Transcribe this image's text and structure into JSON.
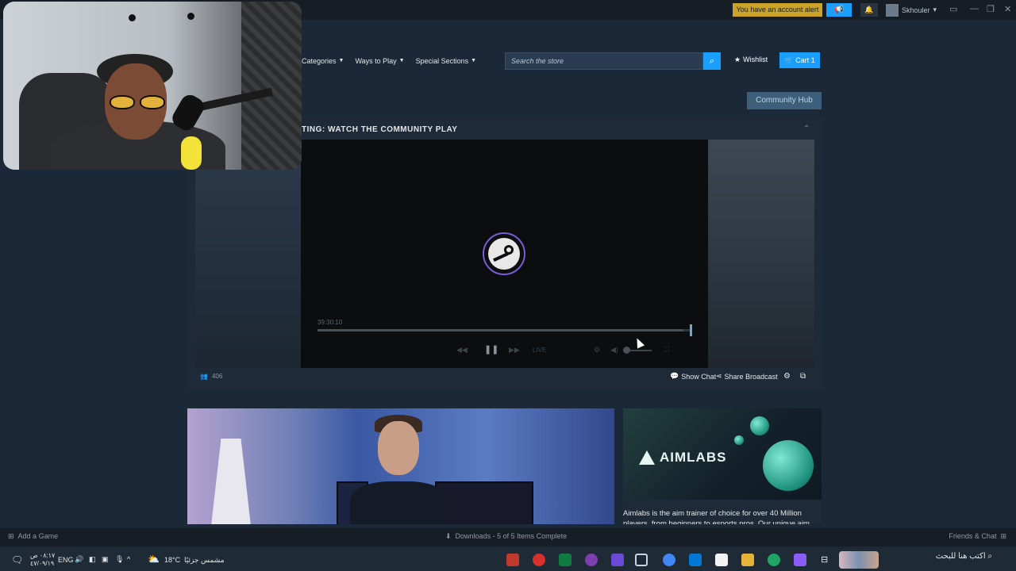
{
  "titlebar": {
    "alert": "You have an account alert",
    "username": "Skhouler"
  },
  "nav": {
    "items": [
      "Categories",
      "Ways to Play",
      "Special Sections"
    ],
    "search_placeholder": "Search the store",
    "wishlist": "Wishlist",
    "cart": "Cart",
    "cart_count": "1"
  },
  "community_hub": "Community Hub",
  "broadcast": {
    "title": "TING: WATCH THE COMMUNITY PLAY",
    "timecode": "39:30:10",
    "progress": 0.98,
    "live_label": "LIVE",
    "viewers": "406",
    "show_chat": "Show Chat",
    "share": "Share Broadcast"
  },
  "aimlabs": {
    "logo": "AIMLABS",
    "desc_line1": "Aimlabs is the aim trainer of choice for over 40 Million",
    "desc_line2": "players, from beginners to esports pros. Our unique aim"
  },
  "steam_bottom": {
    "add_game": "Add a Game",
    "downloads": "Downloads - 5 of 5 Items Complete",
    "friends": "Friends & Chat"
  },
  "taskbar": {
    "time": "٠٨:١٧ ص",
    "date": "٤٧/٠٩/١٩",
    "lang": "ENG",
    "weather_temp": "18°C",
    "weather_text": "مشمس جزئيًا",
    "search": "اكتب هنا للبحث"
  },
  "colors": {
    "accent": "#1a9fff",
    "alert": "#c9a227",
    "background": "#1b2838"
  }
}
